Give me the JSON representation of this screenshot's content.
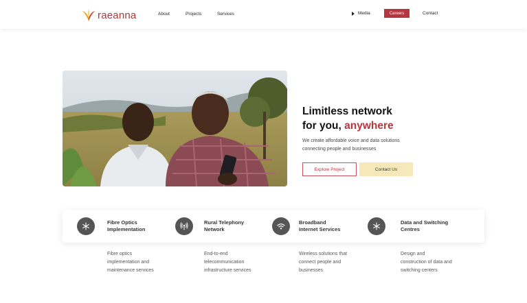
{
  "brand": {
    "name": "raeanna",
    "accent": "#b5363e"
  },
  "nav": {
    "about": "About",
    "projects": "Projects",
    "services": "Services",
    "media": "Media",
    "careers": "Careers",
    "contact": "Contact"
  },
  "hero": {
    "title_line1": "Limitless network",
    "title_line2_prefix": "for you, ",
    "title_line2_accent": "anywhere",
    "desc_line1": "We create affordable voice and data solutions",
    "desc_line2": "connecting people and businesses",
    "explore_button": "Explore Project",
    "contact_button": "Contact Us"
  },
  "services": [
    {
      "icon": "snowflake-icon",
      "title_line1": "Fibre Optics",
      "title_line2": "Implementation",
      "desc": [
        "Fibre optics",
        "implementation and",
        "maintenance services"
      ]
    },
    {
      "icon": "antenna-icon",
      "title_line1": "Rural Telephony",
      "title_line2": "Network",
      "desc": [
        "End-to-end",
        "telecommunication",
        "infrastructure services"
      ]
    },
    {
      "icon": "wifi-icon",
      "title_line1": "Broadband",
      "title_line2": "Internet Services",
      "desc": [
        "Wireless solutions that",
        "connect people and",
        "businesses"
      ]
    },
    {
      "icon": "snowflake-icon",
      "title_line1": "Data and Switching",
      "title_line2": "Centres",
      "desc": [
        "Design and",
        "construction of data and",
        "switching centers"
      ]
    }
  ]
}
